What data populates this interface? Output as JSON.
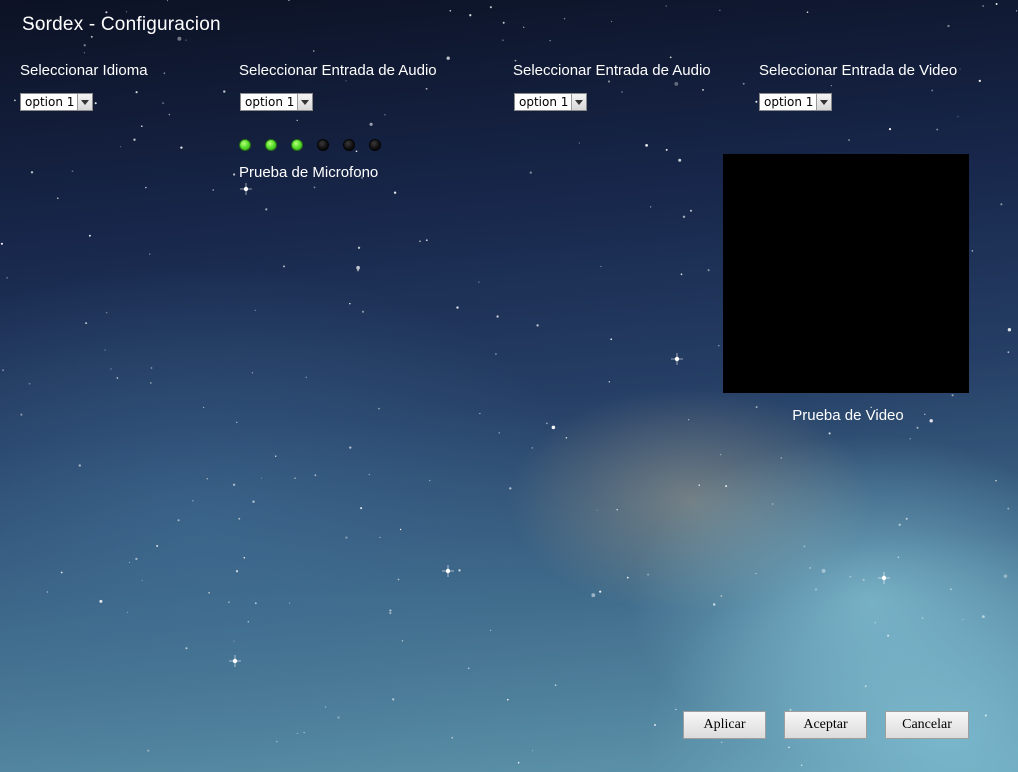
{
  "window": {
    "title": "Sordex - Configuracion"
  },
  "sections": {
    "language": {
      "label": "Seleccionar Idioma",
      "selected": "option 1"
    },
    "audio_input_1": {
      "label": "Seleccionar Entrada de Audio",
      "selected": "option 1"
    },
    "audio_input_2": {
      "label": "Seleccionar Entrada de Audio",
      "selected": "option 1"
    },
    "video_input": {
      "label": "Seleccionar Entrada de Video",
      "selected": "option 1"
    }
  },
  "mic_test": {
    "label": "Prueba de Microfono",
    "level_leds_total": 6,
    "level_leds_lit": 3,
    "lit_color": "#5be030",
    "unlit_color": "#111111"
  },
  "video_test": {
    "label": "Prueba de Video",
    "preview_color": "#000000"
  },
  "buttons": {
    "apply": "Aplicar",
    "accept": "Aceptar",
    "cancel": "Cancelar"
  },
  "icons": {
    "select_arrow": "chevron-down-icon"
  }
}
